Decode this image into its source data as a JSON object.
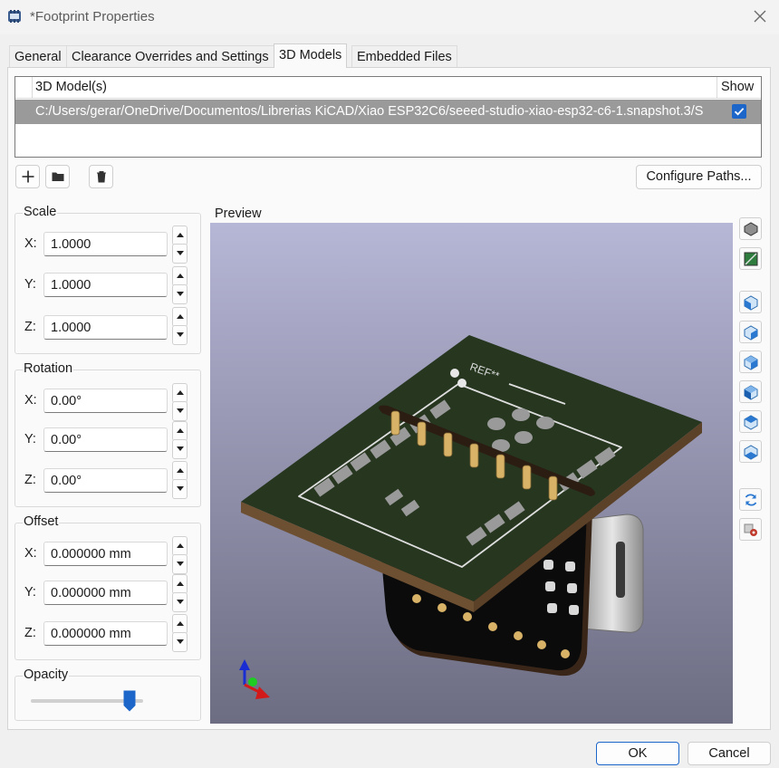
{
  "window": {
    "title": "*Footprint Properties"
  },
  "tabs": [
    {
      "label": "General"
    },
    {
      "label": "Clearance Overrides and Settings"
    },
    {
      "label": "3D Models"
    },
    {
      "label": "Embedded Files"
    }
  ],
  "active_tab": "3D Models",
  "models_table": {
    "col_model": "3D Model(s)",
    "col_show": "Show",
    "rows": [
      {
        "path": "C:/Users/gerar/OneDrive/Documentos/Librerias KiCAD/Xiao ESP32C6/seeed-studio-xiao-esp32-c6-1.snapshot.3/S",
        "show": true
      }
    ]
  },
  "toolbar": {
    "configure_paths": "Configure Paths..."
  },
  "scale": {
    "title": "Scale",
    "x_label": "X:",
    "y_label": "Y:",
    "z_label": "Z:",
    "x": "1.0000",
    "y": "1.0000",
    "z": "1.0000"
  },
  "rotation": {
    "title": "Rotation",
    "x_label": "X:",
    "y_label": "Y:",
    "z_label": "Z:",
    "x": "0.00°",
    "y": "0.00°",
    "z": "0.00°"
  },
  "offset": {
    "title": "Offset",
    "x_label": "X:",
    "y_label": "Y:",
    "z_label": "Z:",
    "x": "0.000000 mm",
    "y": "0.000000 mm",
    "z": "0.000000 mm"
  },
  "opacity": {
    "title": "Opacity",
    "value_fraction": 0.88
  },
  "preview": {
    "label": "Preview",
    "silkscreen_ref": "REF**"
  },
  "colors": {
    "accent": "#1c66c9",
    "selected_row": "#9a9a9a",
    "board_green": "#26361f"
  },
  "buttons": {
    "ok": "OK",
    "cancel": "Cancel"
  }
}
